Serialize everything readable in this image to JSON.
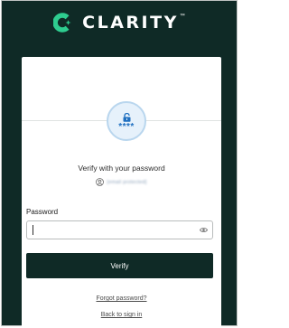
{
  "brand": {
    "name": "CLARITY",
    "trademark": "™",
    "accent_color": "#2ecc8f",
    "background_color": "#0f2a26"
  },
  "lock": {
    "icon": "lock-icon",
    "mask": "****"
  },
  "heading": "Verify with your password",
  "account": {
    "icon": "user-icon",
    "email": "[email protected]"
  },
  "password": {
    "label": "Password",
    "value": "",
    "toggle_icon": "eye-icon"
  },
  "verify_label": "Verify",
  "links": {
    "forgot": "Forgot password?",
    "back": "Back to sign in"
  }
}
